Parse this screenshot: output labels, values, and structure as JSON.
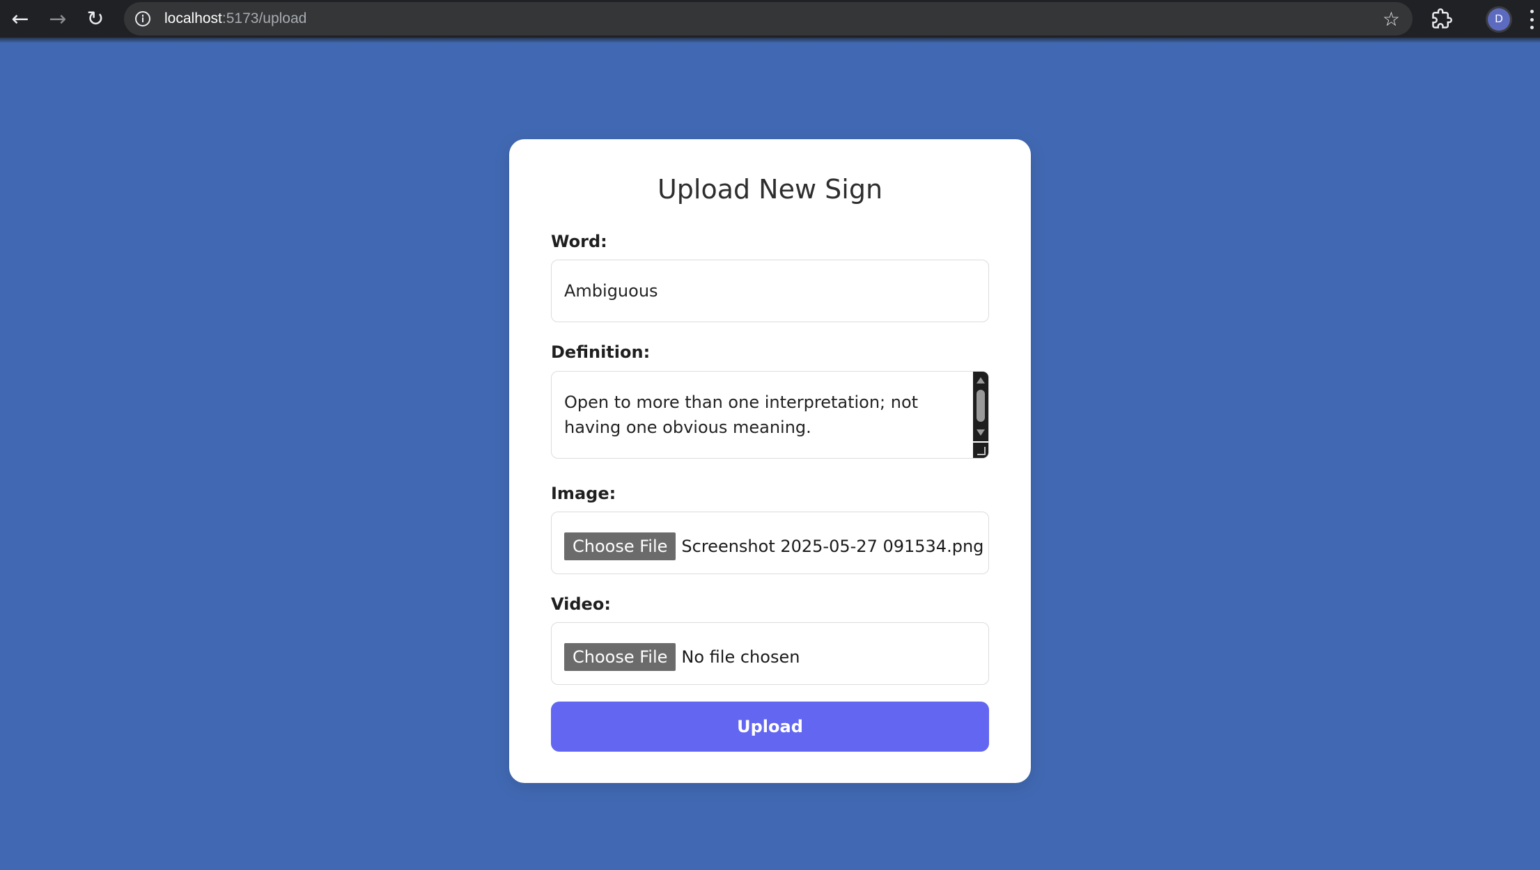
{
  "browser": {
    "url_host": "localhost",
    "url_path": ":5173/upload",
    "back_icon": "←",
    "forward_icon": "→",
    "reload_icon": "↻",
    "star_icon": "☆",
    "profile_initial": "D"
  },
  "form": {
    "title": "Upload New Sign",
    "word": {
      "label": "Word:",
      "value": "Ambiguous"
    },
    "definition": {
      "label": "Definition:",
      "value": "Open to more than one interpretation; not having one obvious meaning."
    },
    "image": {
      "label": "Image:",
      "button_label": "Choose File",
      "file_name": "Screenshot 2025-05-27 091534.png"
    },
    "video": {
      "label": "Video:",
      "button_label": "Choose File",
      "file_name": "No file chosen"
    },
    "submit_label": "Upload"
  },
  "colors": {
    "page_background": "#4169b3",
    "card_background": "#ffffff",
    "primary_button": "#6366f1",
    "file_button": "#6b6b6b",
    "browser_chrome": "#202124"
  }
}
